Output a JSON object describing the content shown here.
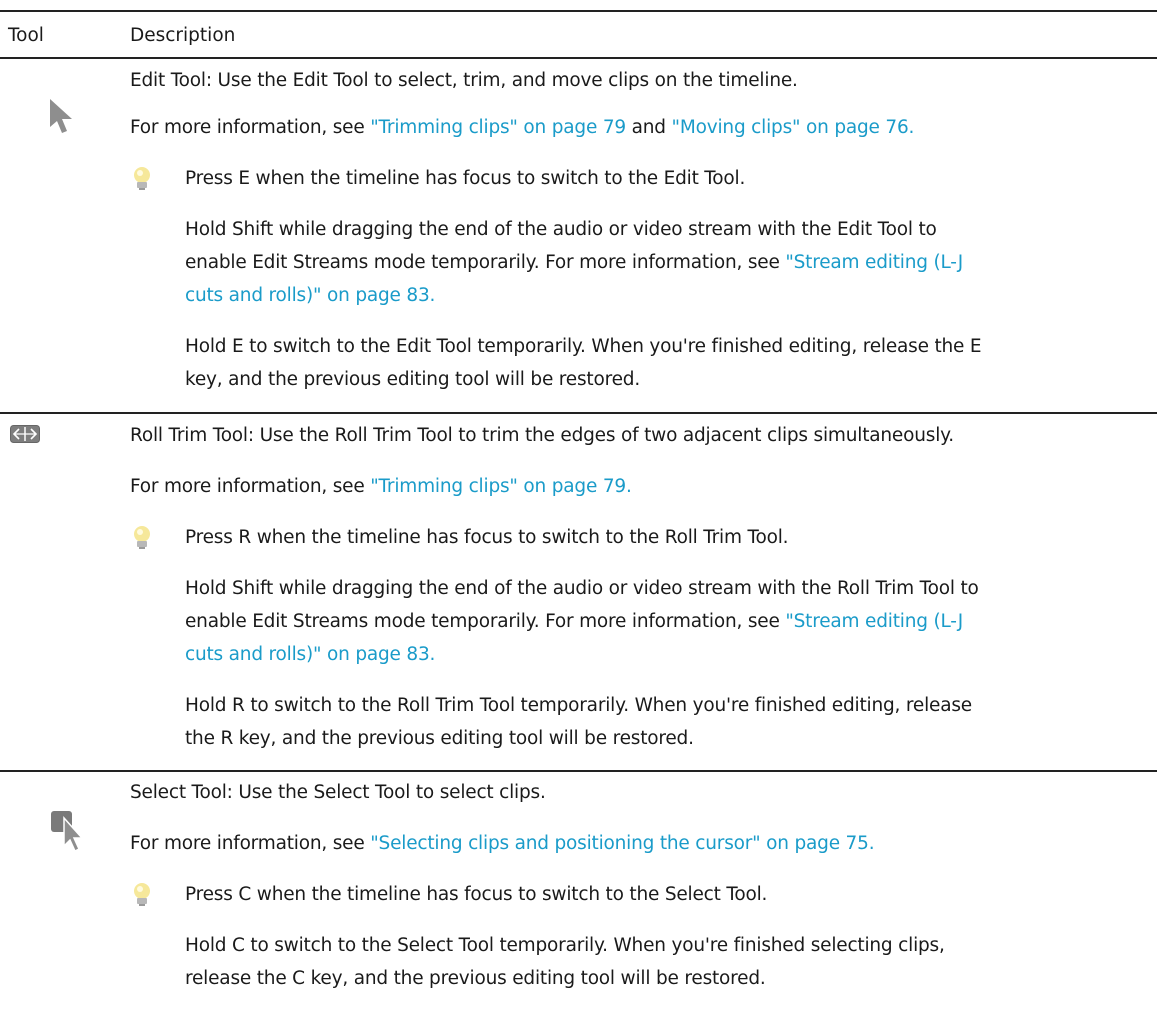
{
  "table": {
    "headers": {
      "tool": "Tool",
      "description": "Description"
    },
    "edit": {
      "icon": "edit-tool-arrow-icon",
      "desc": "Edit Tool: Use the Edit Tool to select, trim, and move clips on the timeline.",
      "more_prefix": "For more information, see ",
      "link1": "\"Trimming clips\" on page 79",
      "and": " and ",
      "link2": "\"Moving clips\" on page 76.",
      "tip_icon": "lightbulb-icon",
      "tip1": "Press E when the timeline has focus to switch to the Edit Tool.",
      "tip2_line1": "Hold Shift while dragging the end of the audio or video stream with the Edit Tool to",
      "tip2_line2_prefix": "enable Edit Streams mode temporarily. For more information, see ",
      "tip2_link_a": "\"Stream editing (L-J",
      "tip2_link_b": "cuts and rolls)\" on page 83.",
      "tip3_line1": "Hold E to switch to the Edit Tool temporarily. When you're finished editing, release the E",
      "tip3_line2": "key, and the previous editing tool will be restored."
    },
    "roll": {
      "icon": "roll-trim-tool-icon",
      "desc": "Roll Trim Tool: Use the Roll Trim Tool to trim the edges of two adjacent clips simultaneously.",
      "more_prefix": "For more information, see ",
      "link1": "\"Trimming clips\" on page 79.",
      "tip_icon": "lightbulb-icon",
      "tip1": "Press R when the timeline has focus to switch to the Roll Trim Tool.",
      "tip2_line1": "Hold Shift while dragging the end of the audio or video stream with the Roll Trim Tool to",
      "tip2_line2_prefix": "enable Edit Streams mode temporarily. For more information, see ",
      "tip2_link_a": "\"Stream editing (L-J",
      "tip2_link_b": "cuts and rolls)\" on page 83.",
      "tip3_line1": "Hold R to switch to the Roll Trim Tool temporarily. When you're finished editing, release",
      "tip3_line2": "the R key, and the previous editing tool will be restored."
    },
    "select": {
      "icon": "select-tool-icon",
      "desc": "Select Tool: Use the Select Tool to select clips.",
      "more_prefix": "For more information, see ",
      "link1": "\"Selecting clips and positioning the cursor\" on page 75.",
      "tip_icon": "lightbulb-icon",
      "tip1": "Press C when the timeline has focus to switch to the Select Tool.",
      "tip3_line1": "Hold C to switch to the Select Tool temporarily. When you're finished selecting clips,",
      "tip3_line2": "release the C key, and the previous editing tool will be restored."
    }
  },
  "colors": {
    "link": "#1a9bc9",
    "rule": "#222222",
    "text": "#1a1a1a"
  }
}
